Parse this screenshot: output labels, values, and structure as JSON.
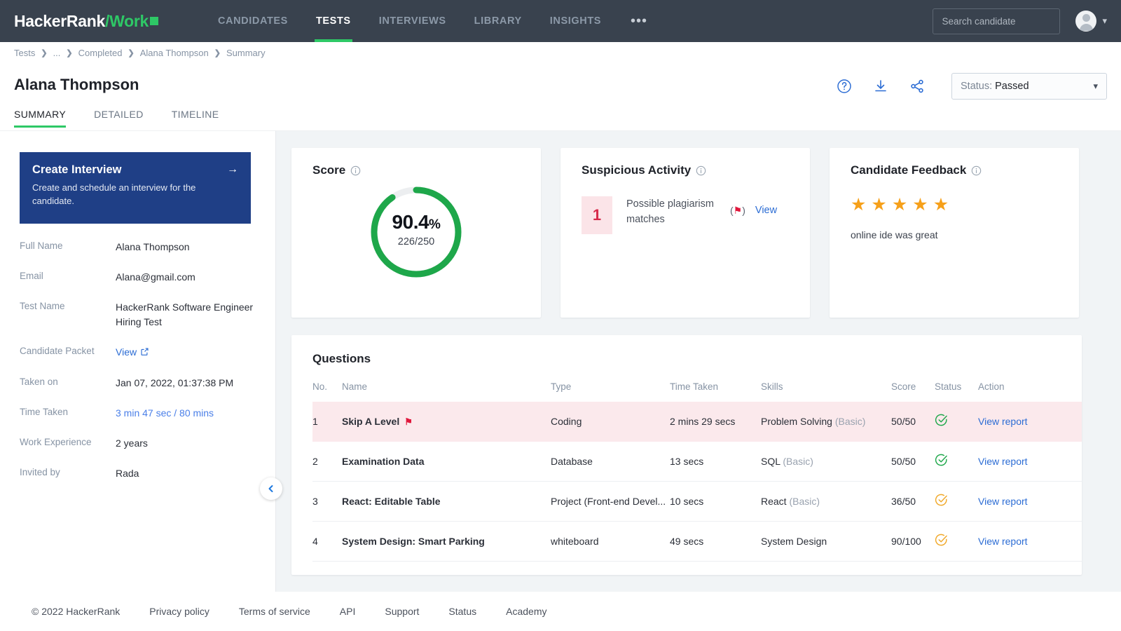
{
  "topnav": {
    "brand": {
      "part1": "HackerRank",
      "part2": "/Work"
    },
    "tabs": [
      {
        "label": "CANDIDATES",
        "active": false
      },
      {
        "label": "TESTS",
        "active": true
      },
      {
        "label": "INTERVIEWS",
        "active": false
      },
      {
        "label": "LIBRARY",
        "active": false
      },
      {
        "label": "INSIGHTS",
        "active": false
      }
    ],
    "overflow": "•••",
    "search_placeholder": "Search candidate",
    "search_value": ""
  },
  "breadcrumb": [
    "Tests",
    "...",
    "Completed",
    "Alana Thompson",
    "Summary"
  ],
  "header": {
    "title": "Alana Thompson",
    "tabs": [
      {
        "label": "SUMMARY",
        "active": true
      },
      {
        "label": "DETAILED",
        "active": false
      },
      {
        "label": "TIMELINE",
        "active": false
      }
    ],
    "status_label": "Status:",
    "status_value": "Passed"
  },
  "sidebar": {
    "create_interview": {
      "title": "Create Interview",
      "subtitle": "Create and schedule an interview for the candidate.",
      "arrow": "→"
    },
    "details": [
      {
        "label": "Full Name",
        "value": "Alana Thompson",
        "style": "plain"
      },
      {
        "label": "Email",
        "value": "Alana@gmail.com",
        "style": "plain"
      },
      {
        "label": "Test Name",
        "value": "HackerRank Software Engineer Hiring Test",
        "style": "plain"
      },
      {
        "label": "Candidate Packet",
        "value": "View",
        "style": "link-external"
      },
      {
        "label": "Taken on",
        "value": "Jan 07, 2022, 01:37:38 PM",
        "style": "plain"
      },
      {
        "label": "Time Taken",
        "value": "3 min 47 sec / 80 mins",
        "style": "link"
      },
      {
        "label": "Work Experience",
        "value": "2 years",
        "style": "plain"
      },
      {
        "label": "Invited by",
        "value": "Rada",
        "style": "plain"
      }
    ]
  },
  "score_card": {
    "title": "Score",
    "percent_text": "90.4",
    "percent_symbol": "%",
    "fraction": "226/250"
  },
  "suspicious_card": {
    "title": "Suspicious Activity",
    "count": "1",
    "text": "Possible plagiarism matches",
    "flag_prefix": "(",
    "flag_suffix": ")",
    "view_label": "View"
  },
  "feedback_card": {
    "title": "Candidate Feedback",
    "rating": 5,
    "comment": "online ide was great"
  },
  "questions": {
    "title": "Questions",
    "columns": [
      "No.",
      "Name",
      "Type",
      "Time Taken",
      "Skills",
      "Score",
      "Status",
      "Action"
    ],
    "rows": [
      {
        "no": "1",
        "name": "Skip A Level",
        "flagged": true,
        "type": "Coding",
        "time": "2 mins 29 secs",
        "skill": "Problem Solving",
        "skill_level": "(Basic)",
        "score": "50/50",
        "status": "complete-green",
        "action": "View report"
      },
      {
        "no": "2",
        "name": "Examination Data",
        "flagged": false,
        "type": "Database",
        "time": "13 secs",
        "skill": "SQL",
        "skill_level": "(Basic)",
        "score": "50/50",
        "status": "complete-green",
        "action": "View report"
      },
      {
        "no": "3",
        "name": "React: Editable Table",
        "flagged": false,
        "type": "Project (Front-end Devel...",
        "time": "10 secs",
        "skill": "React",
        "skill_level": "(Basic)",
        "score": "36/50",
        "status": "partial-orange",
        "action": "View report"
      },
      {
        "no": "4",
        "name": "System Design: Smart Parking",
        "flagged": false,
        "type": "whiteboard",
        "time": "49 secs",
        "skill": "System Design",
        "skill_level": "",
        "score": "90/100",
        "status": "partial-orange",
        "action": "View report"
      }
    ]
  },
  "footer": {
    "items": [
      "© 2022 HackerRank",
      "Privacy policy",
      "Terms of service",
      "API",
      "Support",
      "Status",
      "Academy"
    ]
  },
  "colors": {
    "nav_bg": "#39424e",
    "brand_green": "#2ec866",
    "score_green": "#1ea74a",
    "track_gray": "#eceef0",
    "card_blue": "#1f3f86",
    "link_blue": "#2b6cd4",
    "flag_red": "#e0173c",
    "susp_bg": "#fbe4e8",
    "row_flag_bg": "#fbe9ec",
    "star_orange": "#f6a01a",
    "status_orange": "#f0a828",
    "main_bg": "#f1f4f6"
  }
}
